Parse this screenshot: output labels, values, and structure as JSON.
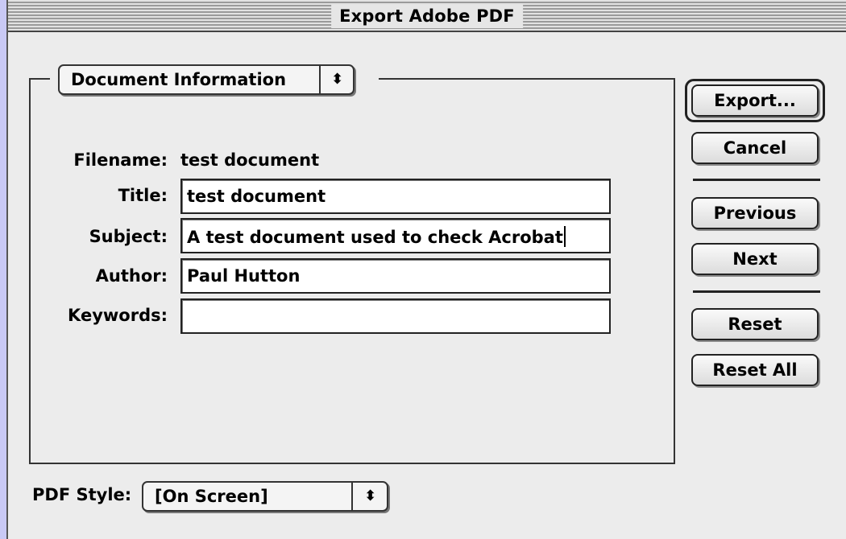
{
  "window": {
    "title": "Export Adobe PDF"
  },
  "section_popup": {
    "value": "Document Information",
    "arrows": "⬍"
  },
  "form": {
    "filename_label": "Filename:",
    "filename_value": "test document",
    "title_label": "Title:",
    "title_value": "test document",
    "subject_label": "Subject:",
    "subject_value": "A test document used to check Acrobat",
    "author_label": "Author:",
    "author_value": "Paul Hutton",
    "keywords_label": "Keywords:",
    "keywords_value": ""
  },
  "buttons": {
    "export": "Export...",
    "cancel": "Cancel",
    "previous": "Previous",
    "next": "Next",
    "reset": "Reset",
    "reset_all": "Reset All"
  },
  "pdf_style": {
    "label": "PDF Style:",
    "value": "[On Screen]",
    "arrows": "⬍"
  }
}
